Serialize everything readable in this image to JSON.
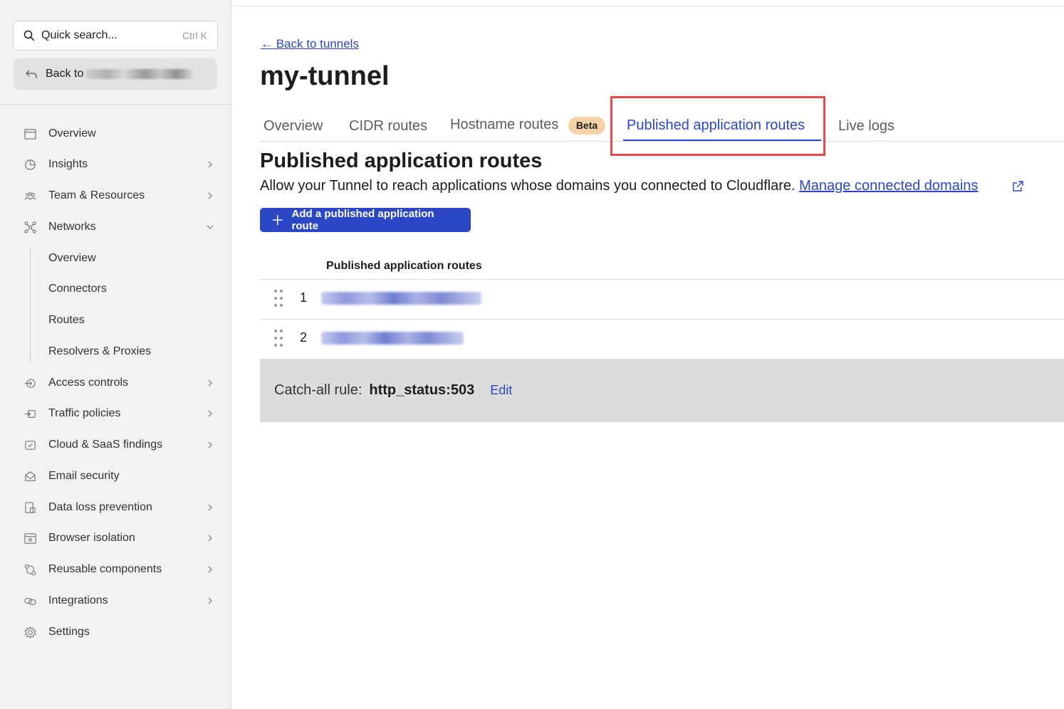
{
  "sidebar": {
    "search": {
      "placeholder": "Quick search...",
      "shortcut": "Ctrl K"
    },
    "back_label": "Back to",
    "items": [
      {
        "label": "Overview",
        "icon": "overview-icon",
        "chevron": "none"
      },
      {
        "label": "Insights",
        "icon": "insights-icon",
        "chevron": "right"
      },
      {
        "label": "Team & Resources",
        "icon": "team-icon",
        "chevron": "right"
      },
      {
        "label": "Networks",
        "icon": "networks-icon",
        "chevron": "down"
      },
      {
        "label": "Access controls",
        "icon": "access-icon",
        "chevron": "right"
      },
      {
        "label": "Traffic policies",
        "icon": "traffic-icon",
        "chevron": "right"
      },
      {
        "label": "Cloud & SaaS findings",
        "icon": "cloud-icon",
        "chevron": "right"
      },
      {
        "label": "Email security",
        "icon": "email-icon",
        "chevron": "none"
      },
      {
        "label": "Data loss prevention",
        "icon": "dlp-icon",
        "chevron": "right"
      },
      {
        "label": "Browser isolation",
        "icon": "browser-icon",
        "chevron": "right"
      },
      {
        "label": "Reusable components",
        "icon": "components-icon",
        "chevron": "right"
      },
      {
        "label": "Integrations",
        "icon": "integrations-icon",
        "chevron": "right"
      },
      {
        "label": "Settings",
        "icon": "settings-icon",
        "chevron": "none"
      }
    ],
    "networks_sub": [
      "Overview",
      "Connectors",
      "Routes",
      "Resolvers & Proxies"
    ]
  },
  "main": {
    "back_link": "← Back to tunnels",
    "title": "my-tunnel",
    "tabs": [
      {
        "label": "Overview",
        "active": false
      },
      {
        "label": "CIDR routes",
        "active": false
      },
      {
        "label": "Hostname routes",
        "active": false,
        "badge": "Beta"
      },
      {
        "label": "Published application routes",
        "active": true
      },
      {
        "label": "Live logs",
        "active": false
      }
    ],
    "section_title": "Published application routes",
    "section_desc": "Allow your Tunnel to reach applications whose domains you connected to Cloudflare.",
    "manage_link": "Manage connected domains",
    "add_button": "Add a published application route",
    "table_header": "Published application routes",
    "rows": [
      "1",
      "2"
    ],
    "catchall_label": "Catch-all rule:",
    "catchall_value": "http_status:503",
    "catchall_edit": "Edit"
  },
  "colors": {
    "accent": "#2c47c5",
    "highlight": "#e5484d",
    "beta_badge": "#f5d3a6"
  }
}
